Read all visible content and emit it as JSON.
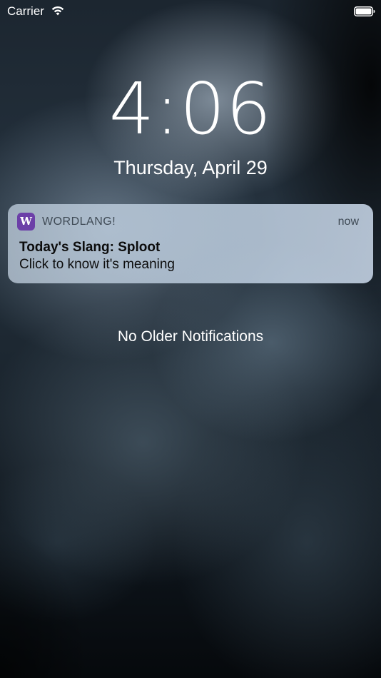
{
  "status_bar": {
    "carrier": "Carrier",
    "wifi_icon": "wifi-icon",
    "battery_icon": "battery-icon"
  },
  "lock_screen": {
    "time": "4:06",
    "date": "Thursday, April 29"
  },
  "notification": {
    "app_icon_letter": "W",
    "app_icon_color": "#6c3fa8",
    "app_name": "WORDLANG!",
    "time": "now",
    "title": "Today's Slang: Sploot",
    "body": "Click to know it's meaning"
  },
  "footer": {
    "no_older_text": "No Older Notifications"
  }
}
